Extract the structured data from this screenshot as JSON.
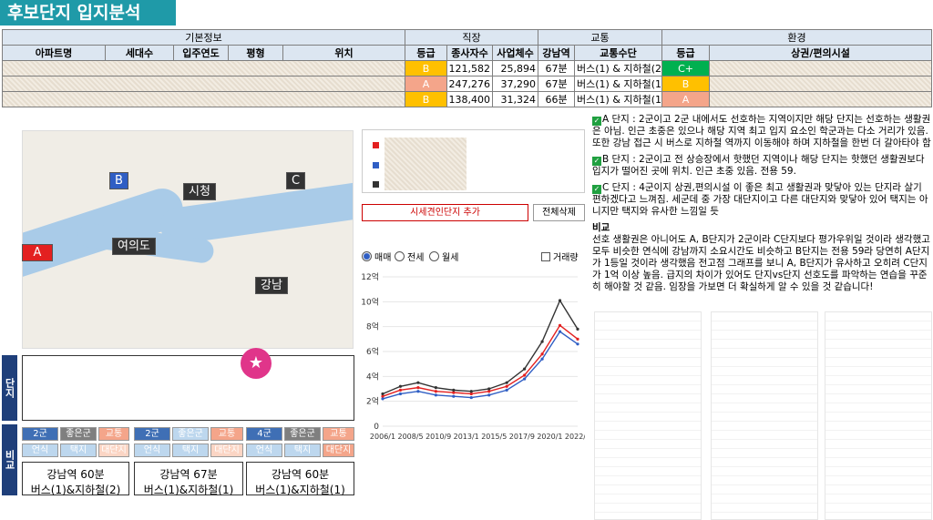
{
  "title": "후보단지 입지분석",
  "table": {
    "groups": [
      "기본정보",
      "직장",
      "교통",
      "환경"
    ],
    "headers": [
      "아파트명",
      "세대수",
      "입주연도",
      "평형",
      "위치",
      "등급",
      "종사자수",
      "사업체수",
      "강남역",
      "교통수단",
      "등급",
      "상권/편의시설"
    ],
    "rows": [
      {
        "grade": "B",
        "workers": "121,582",
        "biz": "25,894",
        "gangnam": "67분",
        "transit": "버스(1) & 지하철(2)",
        "env_grade": "C+"
      },
      {
        "grade": "A",
        "workers": "247,276",
        "biz": "37,290",
        "gangnam": "67분",
        "transit": "버스(1) & 지하철(1)",
        "env_grade": "B"
      },
      {
        "grade": "B",
        "workers": "138,400",
        "biz": "31,324",
        "gangnam": "66분",
        "transit": "버스(1) & 지하철(1)",
        "env_grade": "A"
      }
    ]
  },
  "map": {
    "labels": {
      "b": "B",
      "c": "C",
      "a": "A",
      "sicheong": "시청",
      "yeouido": "여의도",
      "gangnam": "강남"
    }
  },
  "left_panel": {
    "side_danji": "단지",
    "side_bigyo": "비교",
    "chips": [
      [
        "2군",
        "좋은군",
        "교통",
        "언식",
        "택지",
        "대단지"
      ],
      [
        "2군",
        "좋은군",
        "교통",
        "언식",
        "택지",
        "대단지"
      ],
      [
        "4군",
        "좋은군",
        "교통",
        "언식",
        "택지",
        "대단지"
      ]
    ],
    "commute": [
      {
        "line1": "강남역 60분",
        "line2": "버스(1)&지하철(2)"
      },
      {
        "line1": "강남역 67분",
        "line2": "버스(1)&지하철(1)"
      },
      {
        "line1": "강남역 60분",
        "line2": "버스(1)&지하철(1)"
      }
    ]
  },
  "controls": {
    "add_button": "시세견인단지 추가",
    "clear_button": "전체삭제",
    "radios": [
      "매매",
      "전세",
      "월세"
    ],
    "checkbox": "거래량"
  },
  "chart_data": {
    "type": "line",
    "x_ticks": [
      "2006/1",
      "2008/5",
      "2010/9",
      "2013/1",
      "2015/5",
      "2017/9",
      "2020/1",
      "2022/5"
    ],
    "y_ticks": [
      "0",
      "2억",
      "4억",
      "6억",
      "8억",
      "10억",
      "12억"
    ],
    "ylim": [
      0,
      12
    ],
    "series": [
      {
        "color": "#e32020",
        "values": [
          2.4,
          2.9,
          3.1,
          2.8,
          2.7,
          2.6,
          2.8,
          3.2,
          4.1,
          5.8,
          8.1,
          7.0
        ]
      },
      {
        "color": "#2f5ec4",
        "values": [
          2.2,
          2.6,
          2.8,
          2.5,
          2.4,
          2.3,
          2.5,
          2.9,
          3.8,
          5.4,
          7.6,
          6.6
        ]
      },
      {
        "color": "#333333",
        "values": [
          2.6,
          3.2,
          3.5,
          3.1,
          2.9,
          2.8,
          3.0,
          3.5,
          4.6,
          6.8,
          10.1,
          7.8
        ]
      }
    ],
    "legend_colors": [
      "#e32020",
      "#2f5ec4",
      "#333333"
    ]
  },
  "notes": {
    "a": "A 단지 : 2군이고 2군 내에서도 선호하는 지역이지만 해당 단지는 선호하는 생활권은 아님. 인근 초중은 있으나 해당 지역 최고 입지 요소인 학군과는 다소 거리가 있음. 또한 강남 접근 시 버스로 지하철 역까지 이동해야 하며 지하철을 한번 더 갈아타야 함",
    "b": "B 단지 : 2군이고 전 상승장에서 핫했던 지역이나 해당 단지는 핫했던 생활권보다 입지가 떨어진 곳에 위치. 인근 초중 있음. 전용 59.",
    "c": "C 단지 : 4군이지 상권,편의시설 이 좋은 최고 생활권과 맞닿아 있는 단지라 살기 편하겠다고 느껴짐. 세군데 중 가장 대단지이고 다른 대단지와 맞닿아 있어 택지는 아니지만 택지와 유사한 느낌일 듯",
    "heading": "비교",
    "body": "선호 생활권은 아니어도 A, B단지가 2군이라 C단지보다 평가우위일 것이라 생각했고 모두 비슷한 연식에 강남까지 소요시간도 비슷하고 B단지는 전용 59라 당연히 A단지가 1등일 것이라 생각했음 전고점 그래프를 보니 A, B단지가 유사하고 오히려 C단지가 1억 이상 높음. 급지의 차이가 있어도 단지vs단지 선호도를 파악하는 연습을 꾸준히 해야할 것 같음. 임장을 가보면 더 확실하게 알 수 있을 것 같습니다!"
  }
}
